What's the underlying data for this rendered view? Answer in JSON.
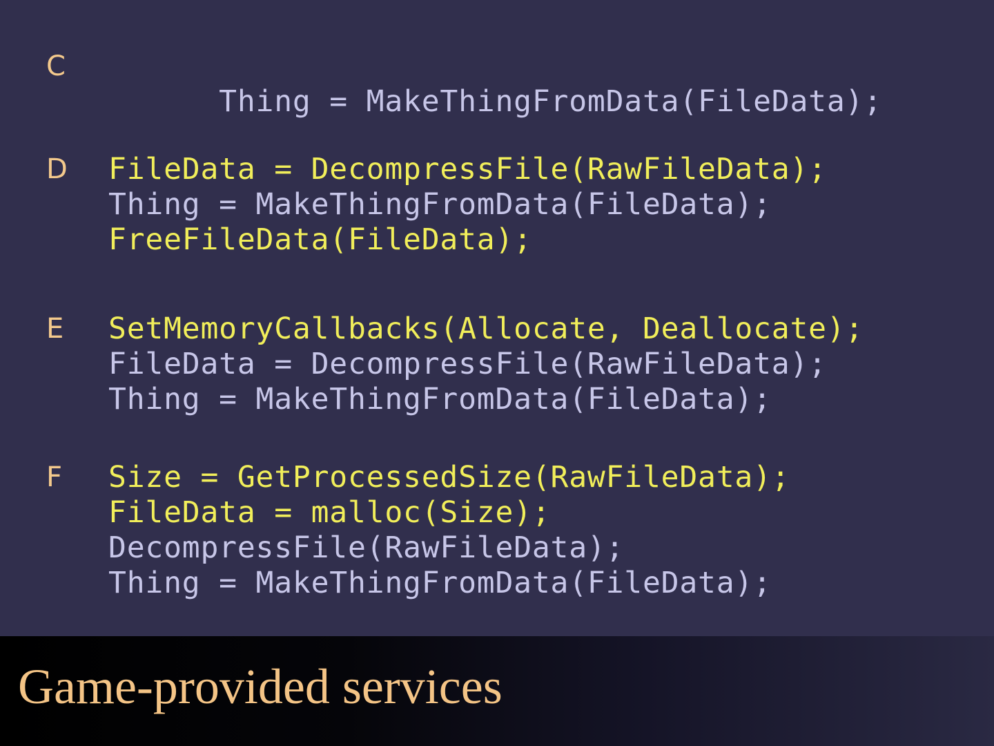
{
  "blocks": [
    {
      "label": "C",
      "lines": [
        {
          "style": "mixed-c",
          "text": "Thing = MakeThingFromData(FileData);"
        }
      ]
    },
    {
      "label": "D",
      "lines": [
        {
          "style": "hl",
          "text": "FileData = DecompressFile(RawFileData);"
        },
        {
          "style": "dim",
          "text": "Thing = MakeThingFromData(FileData);"
        },
        {
          "style": "hl",
          "text": "FreeFileData(FileData);"
        }
      ]
    },
    {
      "label": "E",
      "lines": [
        {
          "style": "hl",
          "text": "SetMemoryCallbacks(Allocate, Deallocate);"
        },
        {
          "style": "dim",
          "text": "FileData = DecompressFile(RawFileData);"
        },
        {
          "style": "dim",
          "text": "Thing = MakeThingFromData(FileData);"
        }
      ]
    },
    {
      "label": "F",
      "lines": [
        {
          "style": "hl",
          "text": "Size = GetProcessedSize(RawFileData);"
        },
        {
          "style": "hl",
          "text": "FileData = malloc(Size);"
        },
        {
          "style": "dim",
          "text": "DecompressFile(RawFileData);"
        },
        {
          "style": "dim",
          "text": "Thing = MakeThingFromData(FileData);"
        }
      ]
    }
  ],
  "footer": {
    "title": "Game-provided services"
  },
  "colors": {
    "background": "#312f4d",
    "label": "#f3c98c",
    "highlight": "#f1ee5a",
    "dim": "#c7c6e8",
    "title": "#f4c486"
  }
}
